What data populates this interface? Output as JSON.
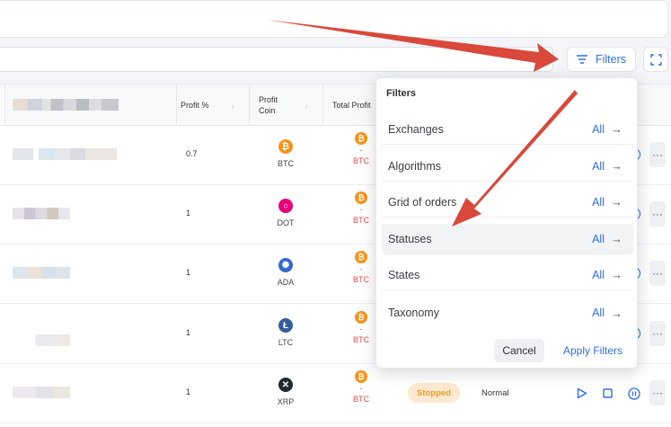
{
  "toolbar": {
    "filters_label": "Filters"
  },
  "table": {
    "columns": {
      "profit_pct": "Profit %",
      "profit_coin_1": "Profit",
      "profit_coin_2": "Coin",
      "total_profit": "Total Profit"
    },
    "rows": [
      {
        "profit": "0.7",
        "coin": "BTC",
        "coin_color": "#f7931a",
        "coin_glyph": "₿",
        "total_dash": "-",
        "total_coin": "BTC"
      },
      {
        "profit": "1",
        "coin": "DOT",
        "coin_color": "#e6007a",
        "coin_glyph": "○",
        "total_dash": "-",
        "total_coin": "BTC"
      },
      {
        "profit": "1",
        "coin": "ADA",
        "coin_color": "#3468d1",
        "coin_glyph": "✺",
        "total_dash": "-",
        "total_coin": "BTC"
      },
      {
        "profit": "1",
        "coin": "LTC",
        "coin_color": "#345d9d",
        "coin_glyph": "Ł",
        "total_dash": "-",
        "total_coin": "BTC"
      },
      {
        "profit": "1",
        "coin": "XRP",
        "coin_color": "#23292f",
        "coin_glyph": "✕",
        "total_dash": "-",
        "total_coin": "BTC",
        "status": "Stopped",
        "state": "Normal"
      }
    ],
    "more_glyph": "···"
  },
  "filters": {
    "title": "Filters",
    "items": [
      {
        "label": "Exchanges",
        "value": "All"
      },
      {
        "label": "Algorithms",
        "value": "All"
      },
      {
        "label": "Grid of orders",
        "value": "All"
      },
      {
        "label": "Statuses",
        "value": "All"
      },
      {
        "label": "States",
        "value": "All"
      },
      {
        "label": "Taxonomy",
        "value": "All"
      }
    ],
    "arrow_glyph": "→",
    "cancel": "Cancel",
    "apply": "Apply Filters"
  },
  "colors": {
    "accent": "#2f6fe0",
    "arrow": "#d9483b",
    "negative": "#e05252"
  },
  "icons": [
    "filter-icon",
    "expand-icon",
    "sort-icon",
    "play-icon",
    "stop-icon",
    "pause-icon",
    "more-icon",
    "arrow-right-icon"
  ]
}
